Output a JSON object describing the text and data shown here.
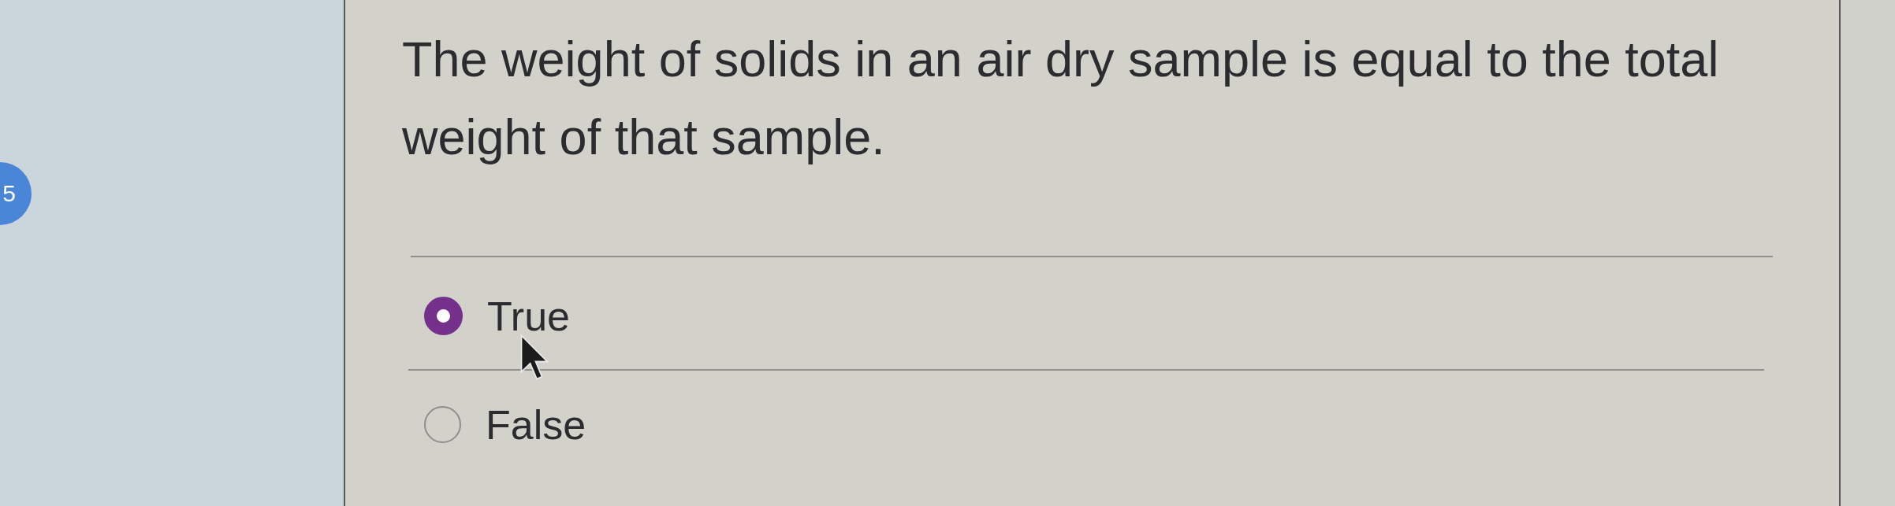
{
  "question_number": {
    "text": "5"
  },
  "question": {
    "text": "The weight of solids in an air dry sample is equal to the total weight of that sample."
  },
  "options": [
    {
      "label": "True",
      "selected": true
    },
    {
      "label": "False",
      "selected": false
    }
  ]
}
